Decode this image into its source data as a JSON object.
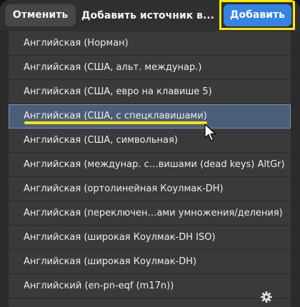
{
  "header": {
    "cancel_label": "Отменить",
    "title": "Добавить источник в...",
    "add_label": "Добавить"
  },
  "list": {
    "items": [
      {
        "label": "Английская (Норман)"
      },
      {
        "label": "Английская (США, альт. междунар.)"
      },
      {
        "label": "Английская (США, евро на клавише 5)"
      },
      {
        "label": "Английская (США, с спецклавишами)",
        "selected": true
      },
      {
        "label": "Английская (США, символьная)"
      },
      {
        "label": "Английская (междунар. с…вишами (dead keys) AltGr)"
      },
      {
        "label": "Английская (ортолинейная Коулмак-DH)"
      },
      {
        "label": "Английская (переключен…ами умножения/деления)"
      },
      {
        "label": "Английская (широкая Коулмак-DH ISO)"
      },
      {
        "label": "Английская (широкая Коулмак-DH)"
      },
      {
        "label": "Английский (en-pn-eqf (m17n))",
        "icon": "gear-icon"
      }
    ]
  },
  "colors": {
    "accent": "#3584e4",
    "annotation": "#ffea00",
    "selection": "#4c5d78"
  }
}
